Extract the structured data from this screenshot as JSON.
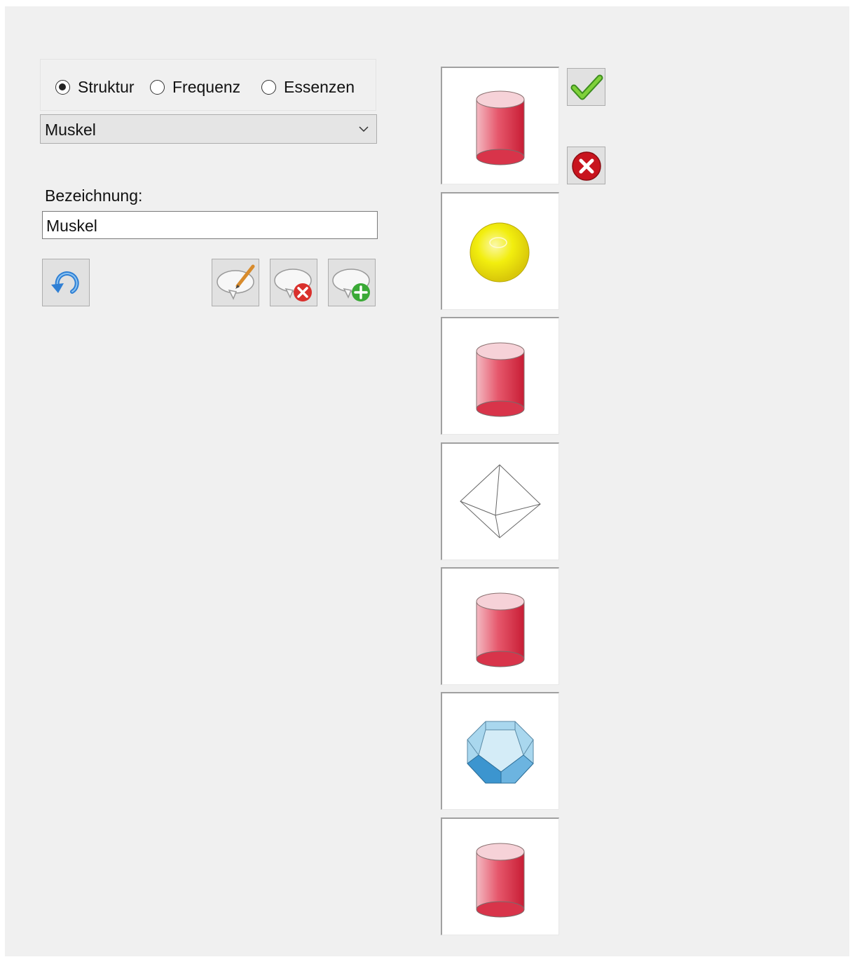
{
  "radio_options": [
    {
      "label": "Struktur",
      "checked": true
    },
    {
      "label": "Frequenz",
      "checked": false
    },
    {
      "label": "Essenzen",
      "checked": false
    }
  ],
  "category_select": {
    "value": "Muskel"
  },
  "name_field": {
    "label": "Bezeichnung:",
    "value": "Muskel"
  },
  "toolbar": {
    "buttons": [
      "undo-icon",
      "edit-comment-icon",
      "delete-comment-icon",
      "add-comment-icon"
    ]
  },
  "side_actions": [
    "confirm-check-icon",
    "cancel-x-icon"
  ],
  "tiles": [
    {
      "shape": "cylinder",
      "color": "#e03a4e"
    },
    {
      "shape": "sphere",
      "color": "#f2ee0e"
    },
    {
      "shape": "cylinder",
      "color": "#e03a4e"
    },
    {
      "shape": "octahedron",
      "color": "#ffffff"
    },
    {
      "shape": "cylinder",
      "color": "#e03a4e"
    },
    {
      "shape": "dodecahedron",
      "color": "#8cc8e6"
    },
    {
      "shape": "cylinder",
      "color": "#e03a4e"
    }
  ]
}
